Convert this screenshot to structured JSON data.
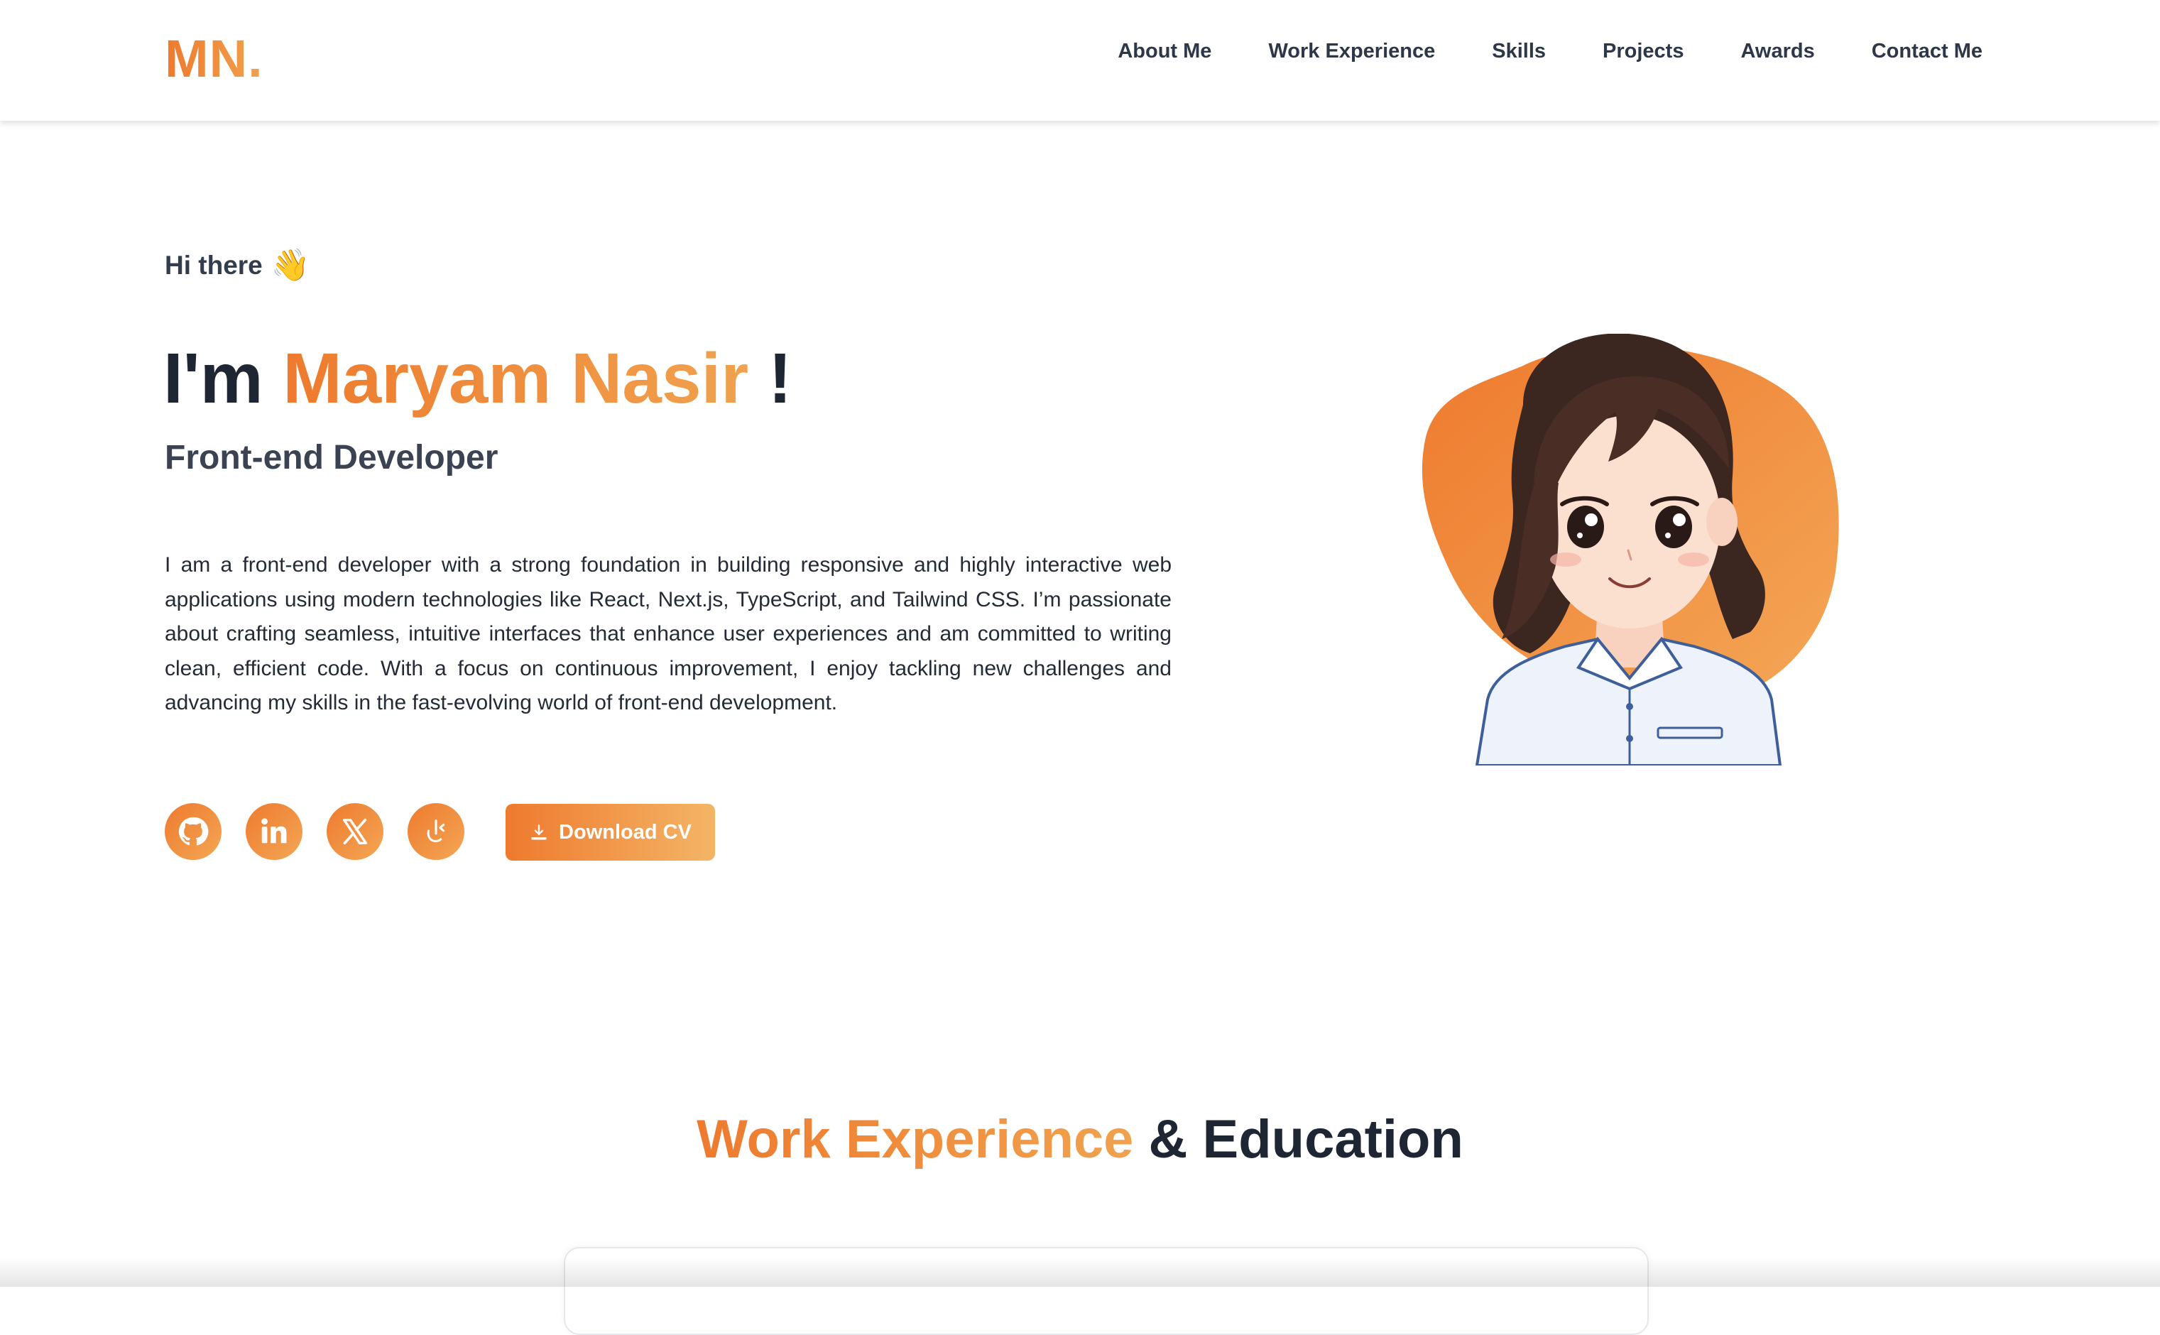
{
  "header": {
    "logo": "MN.",
    "nav": [
      "About Me",
      "Work Experience",
      "Skills",
      "Projects",
      "Awards",
      "Contact Me"
    ]
  },
  "hero": {
    "greeting": "Hi there",
    "greeting_emoji": "👋",
    "headline_prefix": "I'm ",
    "name": "Maryam Nasir",
    "headline_suffix": " !",
    "role": "Front-end Developer",
    "bio": "I am a front-end developer with a strong foundation in building responsive and highly interactive web applications using modern technologies like React, Next.js, TypeScript, and Tailwind CSS. I’m passionate about crafting seamless, intuitive interfaces that enhance user experiences and am committed to writing clean, efficient code. With a focus on continuous improvement, I enjoy tackling new challenges and advancing my skills in the fast-evolving world of front-end development.",
    "socials": [
      "github-icon",
      "linkedin-icon",
      "x-icon",
      "leetcode-icon"
    ],
    "cv_button": "Download CV"
  },
  "section": {
    "title_highlight": "Work Experience",
    "title_rest": " & Education"
  },
  "colors": {
    "accent_start": "#ee7a2e",
    "accent_end": "#f3a755",
    "text_dark": "#1e2533"
  }
}
